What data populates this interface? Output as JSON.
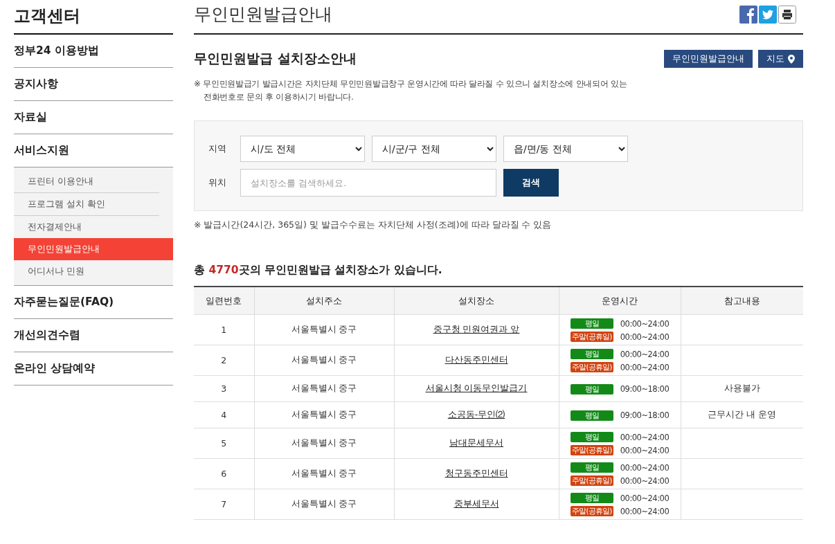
{
  "sidebar": {
    "title": "고객센터",
    "items": [
      {
        "label": "정부24 이용방법",
        "selected": false
      },
      {
        "label": "공지사항",
        "selected": false
      },
      {
        "label": "자료실",
        "selected": false
      },
      {
        "label": "서비스지원",
        "selected": false,
        "children": [
          {
            "label": "프린터 이용안내",
            "selected": false
          },
          {
            "label": "프로그램 설치 확인",
            "selected": false
          },
          {
            "label": "전자결제안내",
            "selected": false
          },
          {
            "label": "무인민원발급안내",
            "selected": true
          },
          {
            "label": "어디서나 민원",
            "selected": false
          }
        ]
      },
      {
        "label": "자주묻는질문(FAQ)",
        "selected": false
      },
      {
        "label": "개선의견수렴",
        "selected": false
      },
      {
        "label": "온라인 상담예약",
        "selected": false
      }
    ]
  },
  "page_title": "무인민원발급안내",
  "section": {
    "title": "무인민원발급 설치장소안내",
    "buttons": [
      {
        "label": "무인민원발급안내",
        "icon": false
      },
      {
        "label": "지도",
        "icon": true
      }
    ],
    "notice": "※ 무인민원발급기 발급시간은 자치단체 무인민원발급창구 운영시간에 따라 달라질 수 있으니 설치장소에 안내되어 있는 전화번호로 문의 후 이용하시기 바랍니다."
  },
  "search": {
    "region_label": "지역",
    "selects": [
      "시/도 전체",
      "시/군/구 전체",
      "읍/면/동 전체"
    ],
    "location_label": "위치",
    "placeholder": "설치장소를 검색하세요.",
    "button": "검색"
  },
  "fee_note": "※ 발급시간(24시간, 365일) 및 발급수수료는 자치단체 사정(조례)에 따라 달라질 수 있음",
  "summary": {
    "prefix": "총 ",
    "count": "4770",
    "suffix": "곳의 무인민원발급 설치장소가 있습니다."
  },
  "table": {
    "columns": [
      "일련번호",
      "설치주소",
      "설치장소",
      "운영시간",
      "참고내용"
    ],
    "rows": [
      {
        "no": "1",
        "address": "서울특별시 중구",
        "place": "중구청 민원여권과 앞",
        "hours": [
          {
            "kind": "weekday",
            "label": "평일",
            "time": "00:00~24:00"
          },
          {
            "kind": "weekend",
            "label": "주말(공휴일)",
            "time": "00:00~24:00"
          }
        ],
        "note": ""
      },
      {
        "no": "2",
        "address": "서울특별시 중구",
        "place": "다산동주민센터",
        "hours": [
          {
            "kind": "weekday",
            "label": "평일",
            "time": "00:00~24:00"
          },
          {
            "kind": "weekend",
            "label": "주말(공휴일)",
            "time": "00:00~24:00"
          }
        ],
        "note": ""
      },
      {
        "no": "3",
        "address": "서울특별시 중구",
        "place": "서울시청 이동무인발급기",
        "hours": [
          {
            "kind": "weekday",
            "label": "평일",
            "time": "09:00~18:00"
          }
        ],
        "note": "사용불가"
      },
      {
        "no": "4",
        "address": "서울특별시 중구",
        "place": "소공동-무인⑵",
        "hours": [
          {
            "kind": "weekday",
            "label": "평일",
            "time": "09:00~18:00"
          }
        ],
        "note": "근무시간 내 운영"
      },
      {
        "no": "5",
        "address": "서울특별시 중구",
        "place": "남대문세무서",
        "hours": [
          {
            "kind": "weekday",
            "label": "평일",
            "time": "00:00~24:00"
          },
          {
            "kind": "weekend",
            "label": "주말(공휴일)",
            "time": "00:00~24:00"
          }
        ],
        "note": ""
      },
      {
        "no": "6",
        "address": "서울특별시 중구",
        "place": "청구동주민센터",
        "hours": [
          {
            "kind": "weekday",
            "label": "평일",
            "time": "00:00~24:00"
          },
          {
            "kind": "weekend",
            "label": "주말(공휴일)",
            "time": "00:00~24:00"
          }
        ],
        "note": ""
      },
      {
        "no": "7",
        "address": "서울특별시 중구",
        "place": "중부세무서",
        "hours": [
          {
            "kind": "weekday",
            "label": "평일",
            "time": "00:00~24:00"
          },
          {
            "kind": "weekend",
            "label": "주말(공휴일)",
            "time": "00:00~24:00"
          }
        ],
        "note": ""
      }
    ]
  }
}
